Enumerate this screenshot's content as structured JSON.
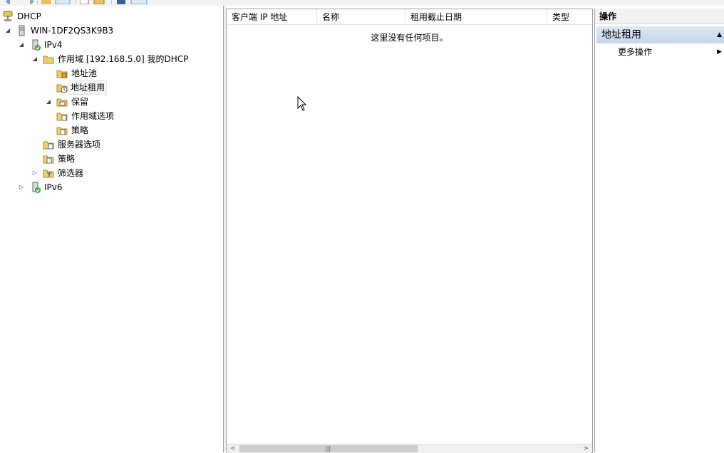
{
  "tree": {
    "root": "DHCP",
    "server": "WIN-1DF2QS3K9B3",
    "ipv4": "IPv4",
    "scope": "作用域 [192.168.5.0] 我的DHCP",
    "address_pool": "地址池",
    "address_leases": "地址租用",
    "reservations": "保留",
    "scope_options": "作用域选项",
    "scope_policies": "策略",
    "server_options": "服务器选项",
    "policies": "策略",
    "filters": "筛选器",
    "ipv6": "IPv6"
  },
  "list": {
    "columns": [
      "客户端 IP 地址",
      "名称",
      "租用截止日期",
      "类型"
    ],
    "empty_message": "这里没有任何项目。"
  },
  "actions": {
    "title": "操作",
    "section": "地址租用",
    "more": "更多操作"
  },
  "colors": {
    "accent_section": "#c8d6ec",
    "folder": "#e8c35a"
  },
  "icons": [
    "dhcp-icon",
    "server-icon",
    "network-icon",
    "folder-icon",
    "address-pool-icon",
    "lease-icon",
    "reservation-icon",
    "options-icon",
    "policy-icon",
    "filter-icon"
  ]
}
